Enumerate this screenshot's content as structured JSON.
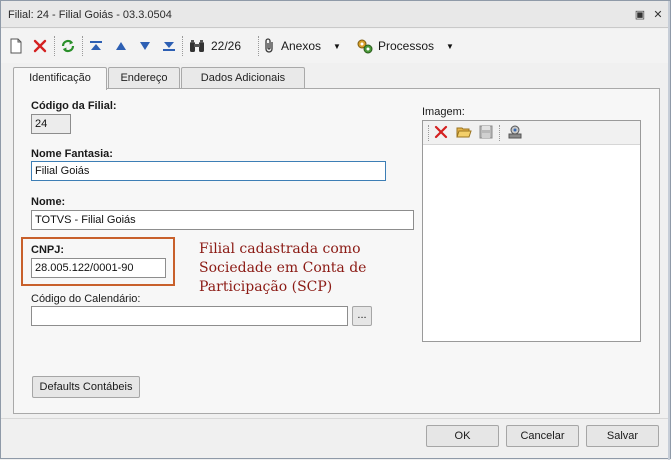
{
  "window": {
    "title": "Filial: 24 - Filial Goiás - 03.3.0504",
    "pin_glyph": "▣",
    "close_glyph": "✕"
  },
  "toolbar": {
    "record_counter": "22/26",
    "attachments_label": "Anexos",
    "processes_label": "Processos",
    "dropdown_glyph": "▼",
    "icons": [
      "new-doc-icon",
      "delete-icon",
      "refresh-icon",
      "first-record-icon",
      "previous-record-icon",
      "next-record-icon",
      "last-record-icon",
      "binoculars-icon",
      "paperclip-icon",
      "gears-icon"
    ]
  },
  "tabs": [
    {
      "label": "Identificação",
      "active": true
    },
    {
      "label": "Endereço",
      "active": false
    },
    {
      "label": "Dados Adicionais",
      "active": false
    }
  ],
  "form": {
    "branch_code_label": "Código da Filial:",
    "branch_code_value": "24",
    "trade_name_label": "Nome Fantasia:",
    "trade_name_value": "Filial Goiás",
    "name_label": "Nome:",
    "name_value": "TOTVS - Filial Goiás",
    "cnpj_label": "CNPJ:",
    "cnpj_value": "28.005.122/0001-90",
    "calendar_label": "Código do Calendário:",
    "calendar_value": "",
    "lookup_label": "...",
    "image_label": "Imagem:",
    "defaults_button": "Defaults Contábeis"
  },
  "annotation": {
    "line1": "Filial cadastrada como",
    "line2": "Sociedade em Conta de",
    "line3": "Participação (SCP)",
    "color": "#8b1a14",
    "box_color": "#c8602b"
  },
  "footer": {
    "ok": "OK",
    "cancel": "Cancelar",
    "save": "Salvar"
  }
}
